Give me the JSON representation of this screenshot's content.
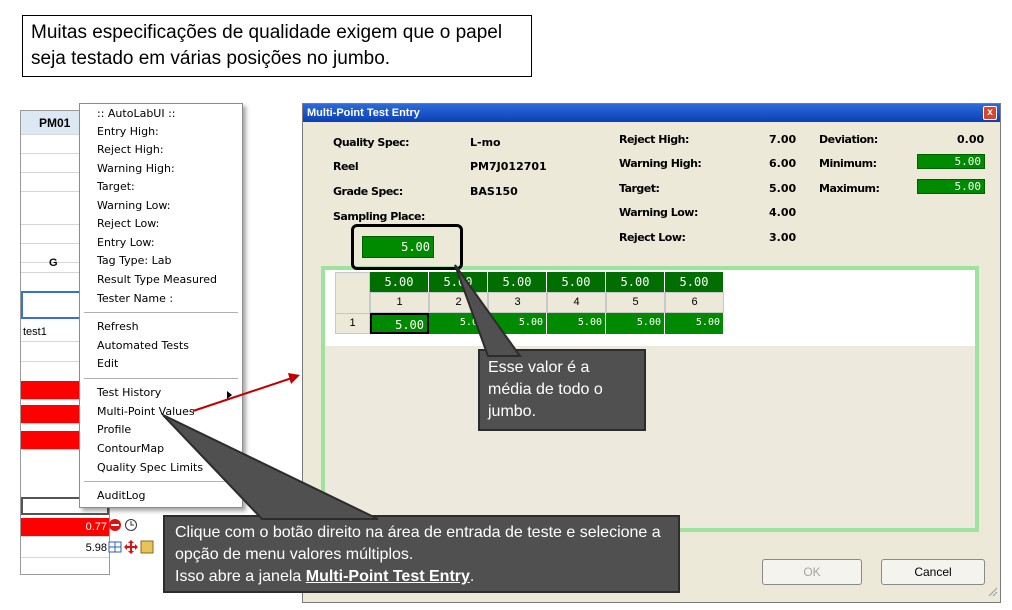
{
  "intro": "Muitas especificações de qualidade exigem que o papel seja testado em várias posições no jumbo.",
  "background_grid": {
    "header": "PM01",
    "cells": [
      "",
      "",
      "",
      "I",
      "",
      "",
      "G",
      "",
      "",
      "test1",
      "A"
    ],
    "values": [
      "0.77",
      "5.98"
    ]
  },
  "context_menu": {
    "header_items": [
      ":: AutoLabUI ::",
      "Entry High:",
      "Reject High:",
      "Warning High:",
      "Target:",
      "Warning Low:",
      "Reject Low:",
      "Entry Low:",
      "Tag Type: Lab",
      "Result Type Measured",
      "Tester Name :"
    ],
    "action_items": [
      "Refresh",
      "Automated Tests",
      "Edit"
    ],
    "view_items": [
      "Test History",
      "Multi-Point Values",
      "Profile",
      "ContourMap",
      "Quality Spec Limits"
    ],
    "footer_items": [
      "AuditLog"
    ]
  },
  "window": {
    "title": "Multi-Point Test Entry",
    "close_glyph": "x",
    "left_fields": [
      {
        "label": "Quality Spec:",
        "value": "L-mo"
      },
      {
        "label": "Reel",
        "value": "PM7J012701"
      },
      {
        "label": "Grade Spec:",
        "value": "BAS150"
      },
      {
        "label": "Sampling Place:",
        "value": ""
      }
    ],
    "limits": [
      {
        "label": "Reject High:",
        "value": "7.00"
      },
      {
        "label": "Warning High:",
        "value": "6.00"
      },
      {
        "label": "Target:",
        "value": "5.00"
      },
      {
        "label": "Warning Low:",
        "value": "4.00"
      },
      {
        "label": "Reject Low:",
        "value": "3.00"
      }
    ],
    "stats": [
      {
        "label": "Deviation:",
        "value": "0.00"
      },
      {
        "label": "Minimum:",
        "value": "5.00"
      },
      {
        "label": "Maximum:",
        "value": "5.00"
      }
    ],
    "average": "5.00",
    "grid": {
      "column_averages": [
        "5.00",
        "5.00",
        "5.00",
        "5.00",
        "5.00",
        "5.00"
      ],
      "column_numbers": [
        "1",
        "2",
        "3",
        "4",
        "5",
        "6"
      ],
      "row_label": "1",
      "row_values": [
        "5.00",
        "5.00",
        "5.00",
        "5.00",
        "5.00",
        "5.00"
      ]
    },
    "buttons": {
      "ok": "OK",
      "cancel": "Cancel"
    }
  },
  "callouts": {
    "average_note": "Esse valor é a média de todo o jumbo.",
    "instructions_line1": "Clique com o botão direito na área de entrada de teste e selecione a opção de menu valores múltiplos.",
    "instructions_line2": "Isso abre a janela ",
    "instructions_link": "Multi-Point Test Entry",
    "instructions_end": "."
  },
  "colors": {
    "accent_green": "#008a00",
    "grid_border": "#9de39d",
    "alert_red": "#ff0000",
    "callout_gray": "#505050",
    "arrow_red": "#c00000"
  }
}
